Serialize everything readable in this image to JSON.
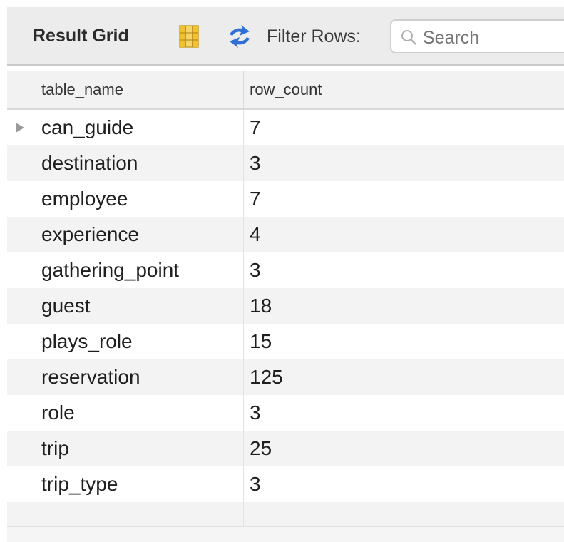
{
  "toolbar": {
    "title": "Result Grid",
    "filter_label": "Filter Rows:",
    "search_placeholder": "Search",
    "icons": [
      "grid-layout-icon",
      "refresh-icon",
      "search-icon"
    ]
  },
  "grid": {
    "columns": [
      "table_name",
      "row_count"
    ],
    "rows": [
      {
        "table_name": "can_guide",
        "row_count": "7"
      },
      {
        "table_name": "destination",
        "row_count": "3"
      },
      {
        "table_name": "employee",
        "row_count": "7"
      },
      {
        "table_name": "experience",
        "row_count": "4"
      },
      {
        "table_name": "gathering_point",
        "row_count": "3"
      },
      {
        "table_name": "guest",
        "row_count": "18"
      },
      {
        "table_name": "plays_role",
        "row_count": "15"
      },
      {
        "table_name": "reservation",
        "row_count": "125"
      },
      {
        "table_name": "role",
        "row_count": "3"
      },
      {
        "table_name": "trip",
        "row_count": "25"
      },
      {
        "table_name": "trip_type",
        "row_count": "3"
      }
    ]
  },
  "colors": {
    "toolbar_bg": "#ececec",
    "row_alt_bg": "#f3f3f3",
    "refresh_blue": "#2f6fd6",
    "grid_icon_yellow": "#f2c12e"
  }
}
